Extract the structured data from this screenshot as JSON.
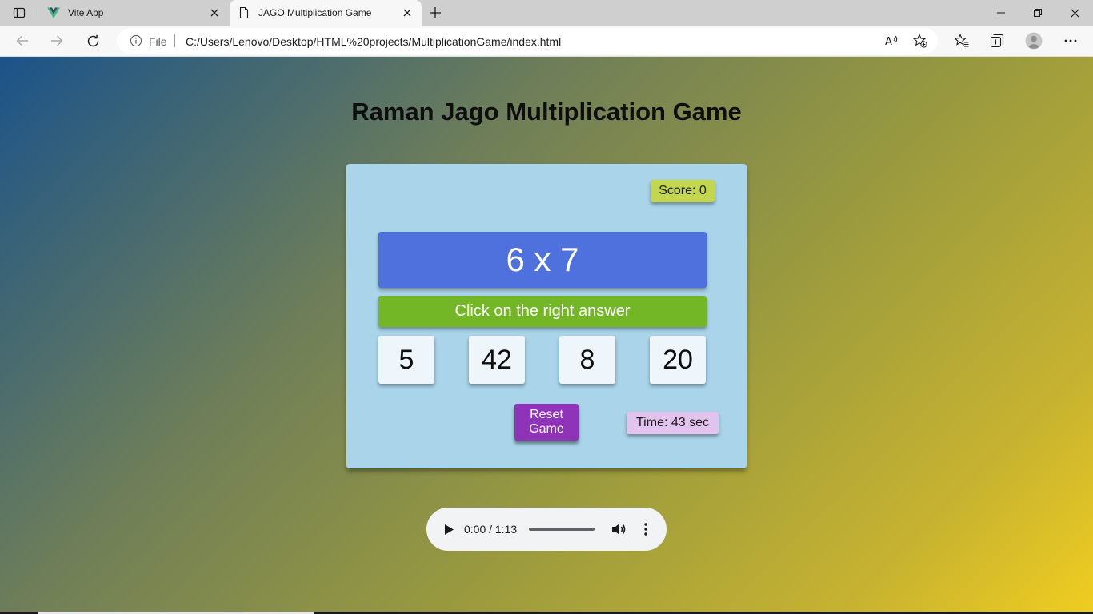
{
  "browser": {
    "tabs": [
      {
        "title": "Vite App",
        "icon": "vue-logo-icon",
        "active": false
      },
      {
        "title": "JAGO Multiplication Game",
        "icon": "page-icon",
        "active": true
      }
    ],
    "address": {
      "scheme_label": "File",
      "url": "C:/Users/Lenovo/Desktop/HTML%20projects/MultiplicationGame/index.html"
    }
  },
  "game": {
    "title": "Raman Jago Multiplication Game",
    "score_text": "Score: 0",
    "question": "6 x 7",
    "instruction": "Click on the right answer",
    "choices": [
      "5",
      "42",
      "8",
      "20"
    ],
    "reset_line1": "Reset",
    "reset_line2": "Game",
    "time_text": "Time: 43 sec"
  },
  "audio": {
    "time_text": "0:00 / 1:13"
  },
  "colors": {
    "score_bg": "#c2d64f",
    "question_bg": "#4f71dd",
    "instruction_bg": "#74b726",
    "reset_bg": "#8f33b8",
    "timer_bg": "#e2c3ed",
    "card_bg": "#a9d4e9"
  }
}
